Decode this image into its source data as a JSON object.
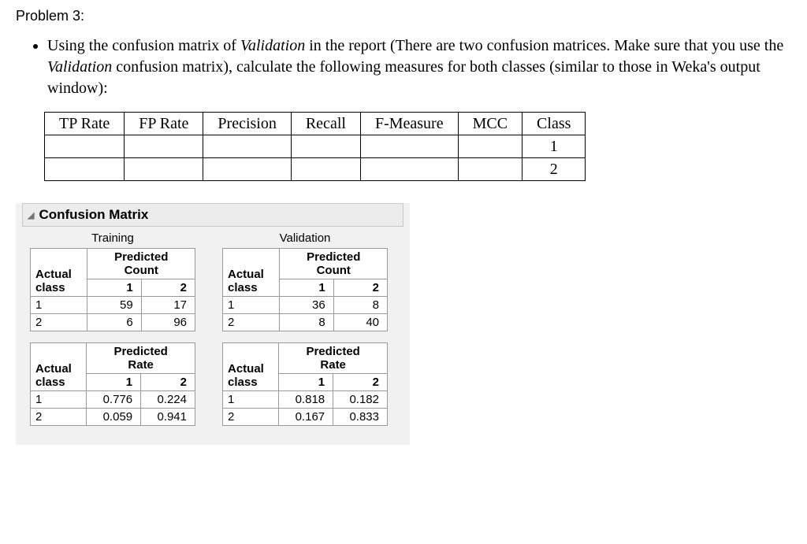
{
  "title": "Problem 3:",
  "bullet": {
    "p1a": "Using the confusion matrix of ",
    "p1b": "Validation",
    "p1c": " in the report (There are two confusion matrices. Make sure that you use the ",
    "p1d": "Validation",
    "p1e": " confusion matrix), calculate the following measures for both classes (similar to those in Weka's output window):"
  },
  "measures": {
    "headers": [
      "TP Rate",
      "FP Rate",
      "Precision",
      "Recall",
      "F-Measure",
      "MCC",
      "Class"
    ],
    "rows": [
      {
        "tp": "",
        "fp": "",
        "prec": "",
        "rec": "",
        "fm": "",
        "mcc": "",
        "cls": "1"
      },
      {
        "tp": "",
        "fp": "",
        "prec": "",
        "rec": "",
        "fm": "",
        "mcc": "",
        "cls": "2"
      }
    ]
  },
  "cm": {
    "section_title": "Confusion Matrix",
    "col_titles": {
      "train": "Training",
      "valid": "Validation"
    },
    "labels": {
      "actual": "Actual",
      "class": "class",
      "predicted": "Predicted",
      "count": "Count",
      "rate": "Rate",
      "c1": "1",
      "c2": "2"
    },
    "train_count": {
      "r1": {
        "cls": "1",
        "c1": "59",
        "c2": "17"
      },
      "r2": {
        "cls": "2",
        "c1": "6",
        "c2": "96"
      }
    },
    "valid_count": {
      "r1": {
        "cls": "1",
        "c1": "36",
        "c2": "8"
      },
      "r2": {
        "cls": "2",
        "c1": "8",
        "c2": "40"
      }
    },
    "train_rate": {
      "r1": {
        "cls": "1",
        "c1": "0.776",
        "c2": "0.224"
      },
      "r2": {
        "cls": "2",
        "c1": "0.059",
        "c2": "0.941"
      }
    },
    "valid_rate": {
      "r1": {
        "cls": "1",
        "c1": "0.818",
        "c2": "0.182"
      },
      "r2": {
        "cls": "2",
        "c1": "0.167",
        "c2": "0.833"
      }
    }
  }
}
